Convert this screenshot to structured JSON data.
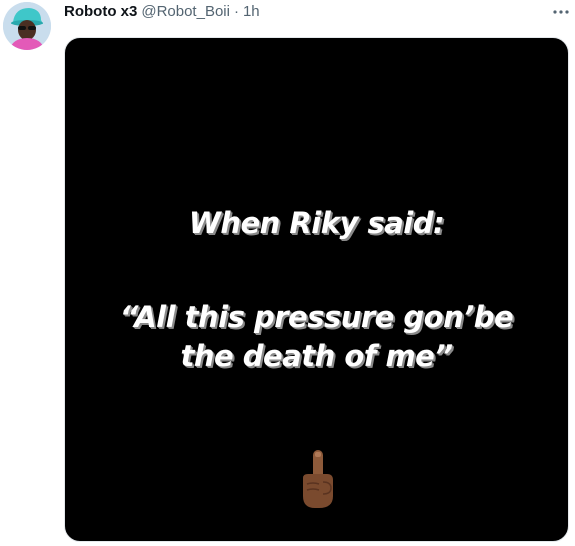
{
  "tweet": {
    "display_name": "Roboto x3",
    "handle": "@Robot_Boii",
    "separator": "·",
    "time": "1h",
    "more_label": "···"
  },
  "media": {
    "heading": "When Riky said:",
    "quote_line1": "“All this pressure gon’be",
    "quote_line2": "the death of me”",
    "emoji": "point-up-emoji"
  },
  "icons": {
    "more": "more-icon",
    "avatar": "avatar"
  },
  "colors": {
    "text_primary": "#0f1419",
    "text_secondary": "#536471",
    "media_background": "#000000"
  }
}
